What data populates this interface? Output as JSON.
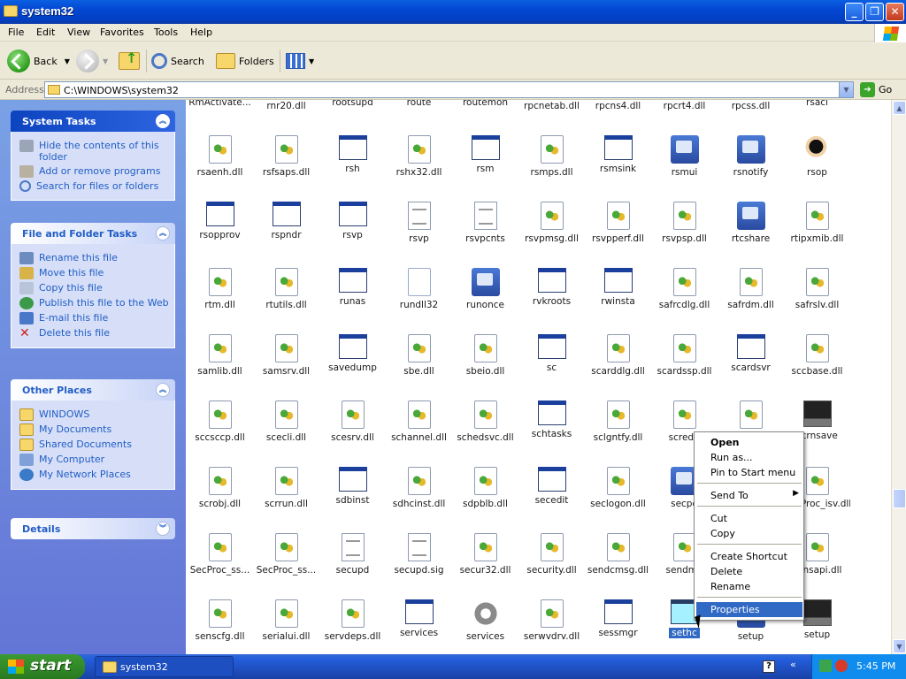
{
  "window": {
    "title": "system32"
  },
  "menu": [
    "File",
    "Edit",
    "View",
    "Favorites",
    "Tools",
    "Help"
  ],
  "toolbar": {
    "back": "Back",
    "search": "Search",
    "folders": "Folders"
  },
  "address": {
    "label": "Address",
    "path": "C:\\WINDOWS\\system32",
    "go": "Go"
  },
  "system_tasks": {
    "title": "System Tasks",
    "items": [
      "Hide the contents of this folder",
      "Add or remove programs",
      "Search for files or folders"
    ]
  },
  "file_tasks": {
    "title": "File and Folder Tasks",
    "items": [
      "Rename this file",
      "Move this file",
      "Copy this file",
      "Publish this file to the Web",
      "E-mail this file",
      "Delete this file"
    ]
  },
  "other_places": {
    "title": "Other Places",
    "items": [
      "WINDOWS",
      "My Documents",
      "Shared Documents",
      "My Computer",
      "My Network Places"
    ]
  },
  "details": {
    "title": "Details"
  },
  "files": [
    {
      "name": "RmActivate...",
      "type": "exe"
    },
    {
      "name": "rnr20.dll",
      "type": "dll"
    },
    {
      "name": "rootsupd",
      "type": "exe"
    },
    {
      "name": "route",
      "type": "exe"
    },
    {
      "name": "routemon",
      "type": "exe"
    },
    {
      "name": "rpcnetab.dll",
      "type": "dll"
    },
    {
      "name": "rpcns4.dll",
      "type": "dll"
    },
    {
      "name": "rpcrt4.dll",
      "type": "dll"
    },
    {
      "name": "rpcss.dll",
      "type": "dll"
    },
    {
      "name": "rsaci",
      "type": "exe"
    },
    {
      "name": "rsaenh.dll",
      "type": "dll"
    },
    {
      "name": "rsfsaps.dll",
      "type": "dll"
    },
    {
      "name": "rsh",
      "type": "exe"
    },
    {
      "name": "rshx32.dll",
      "type": "dll"
    },
    {
      "name": "rsm",
      "type": "exe"
    },
    {
      "name": "rsmps.dll",
      "type": "dll"
    },
    {
      "name": "rsmsink",
      "type": "exe"
    },
    {
      "name": "rsmui",
      "type": "app"
    },
    {
      "name": "rsnotify",
      "type": "app"
    },
    {
      "name": "rsop",
      "type": "people"
    },
    {
      "name": "rsopprov",
      "type": "exe"
    },
    {
      "name": "rspndr",
      "type": "exe"
    },
    {
      "name": "rsvp",
      "type": "exe"
    },
    {
      "name": "rsvp",
      "type": "doc"
    },
    {
      "name": "rsvpcnts",
      "type": "doc"
    },
    {
      "name": "rsvpmsg.dll",
      "type": "dll"
    },
    {
      "name": "rsvpperf.dll",
      "type": "dll"
    },
    {
      "name": "rsvpsp.dll",
      "type": "dll"
    },
    {
      "name": "rtcshare",
      "type": "app"
    },
    {
      "name": "rtipxmib.dll",
      "type": "dll"
    },
    {
      "name": "rtm.dll",
      "type": "dll"
    },
    {
      "name": "rtutils.dll",
      "type": "dll"
    },
    {
      "name": "runas",
      "type": "exe"
    },
    {
      "name": "rundll32",
      "type": "blank"
    },
    {
      "name": "runonce",
      "type": "app"
    },
    {
      "name": "rvkroots",
      "type": "exe"
    },
    {
      "name": "rwinsta",
      "type": "exe"
    },
    {
      "name": "safrcdlg.dll",
      "type": "dll"
    },
    {
      "name": "safrdm.dll",
      "type": "dll"
    },
    {
      "name": "safrslv.dll",
      "type": "dll"
    },
    {
      "name": "samlib.dll",
      "type": "dll"
    },
    {
      "name": "samsrv.dll",
      "type": "dll"
    },
    {
      "name": "savedump",
      "type": "exe"
    },
    {
      "name": "sbe.dll",
      "type": "dll"
    },
    {
      "name": "sbeio.dll",
      "type": "dll"
    },
    {
      "name": "sc",
      "type": "exe"
    },
    {
      "name": "scarddlg.dll",
      "type": "dll"
    },
    {
      "name": "scardssp.dll",
      "type": "dll"
    },
    {
      "name": "scardsvr",
      "type": "exe"
    },
    {
      "name": "sccbase.dll",
      "type": "dll"
    },
    {
      "name": "sccsccp.dll",
      "type": "dll"
    },
    {
      "name": "scecli.dll",
      "type": "dll"
    },
    {
      "name": "scesrv.dll",
      "type": "dll"
    },
    {
      "name": "schannel.dll",
      "type": "dll"
    },
    {
      "name": "schedsvc.dll",
      "type": "dll"
    },
    {
      "name": "schtasks",
      "type": "exe"
    },
    {
      "name": "sclgntfy.dll",
      "type": "dll"
    },
    {
      "name": "scredir",
      "type": "dll"
    },
    {
      "name": "",
      "type": "dll"
    },
    {
      "name": "scrnsave",
      "type": "pc"
    },
    {
      "name": "scrobj.dll",
      "type": "dll"
    },
    {
      "name": "scrrun.dll",
      "type": "dll"
    },
    {
      "name": "sdbinst",
      "type": "exe"
    },
    {
      "name": "sdhcinst.dll",
      "type": "dll"
    },
    {
      "name": "sdpblb.dll",
      "type": "dll"
    },
    {
      "name": "secedit",
      "type": "exe"
    },
    {
      "name": "seclogon.dll",
      "type": "dll"
    },
    {
      "name": "secpo",
      "type": "app"
    },
    {
      "name": "",
      "type": "dll"
    },
    {
      "name": "SecProc_isv.dll",
      "type": "dll"
    },
    {
      "name": "SecProc_ss...",
      "type": "dll"
    },
    {
      "name": "SecProc_ss...",
      "type": "dll"
    },
    {
      "name": "secupd",
      "type": "doc"
    },
    {
      "name": "secupd.sig",
      "type": "doc"
    },
    {
      "name": "secur32.dll",
      "type": "dll"
    },
    {
      "name": "security.dll",
      "type": "dll"
    },
    {
      "name": "sendcmsg.dll",
      "type": "dll"
    },
    {
      "name": "sendma",
      "type": "dll"
    },
    {
      "name": "",
      "type": "dll"
    },
    {
      "name": "sensapi.dll",
      "type": "dll"
    },
    {
      "name": "senscfg.dll",
      "type": "dll"
    },
    {
      "name": "serialui.dll",
      "type": "dll"
    },
    {
      "name": "servdeps.dll",
      "type": "dll"
    },
    {
      "name": "services",
      "type": "exe"
    },
    {
      "name": "services",
      "type": "gear"
    },
    {
      "name": "serwvdrv.dll",
      "type": "dll"
    },
    {
      "name": "sessmgr",
      "type": "exe"
    },
    {
      "name": "sethc",
      "type": "exe",
      "selected": true
    },
    {
      "name": "setup",
      "type": "app"
    },
    {
      "name": "setup",
      "type": "pc"
    }
  ],
  "context_menu": {
    "open": "Open",
    "run_as": "Run as...",
    "pin": "Pin to Start menu",
    "send_to": "Send To",
    "cut": "Cut",
    "copy": "Copy",
    "create_shortcut": "Create Shortcut",
    "delete": "Delete",
    "rename": "Rename",
    "properties": "Properties"
  },
  "taskbar": {
    "start": "start",
    "task": "system32",
    "clock": "5:45 PM"
  }
}
